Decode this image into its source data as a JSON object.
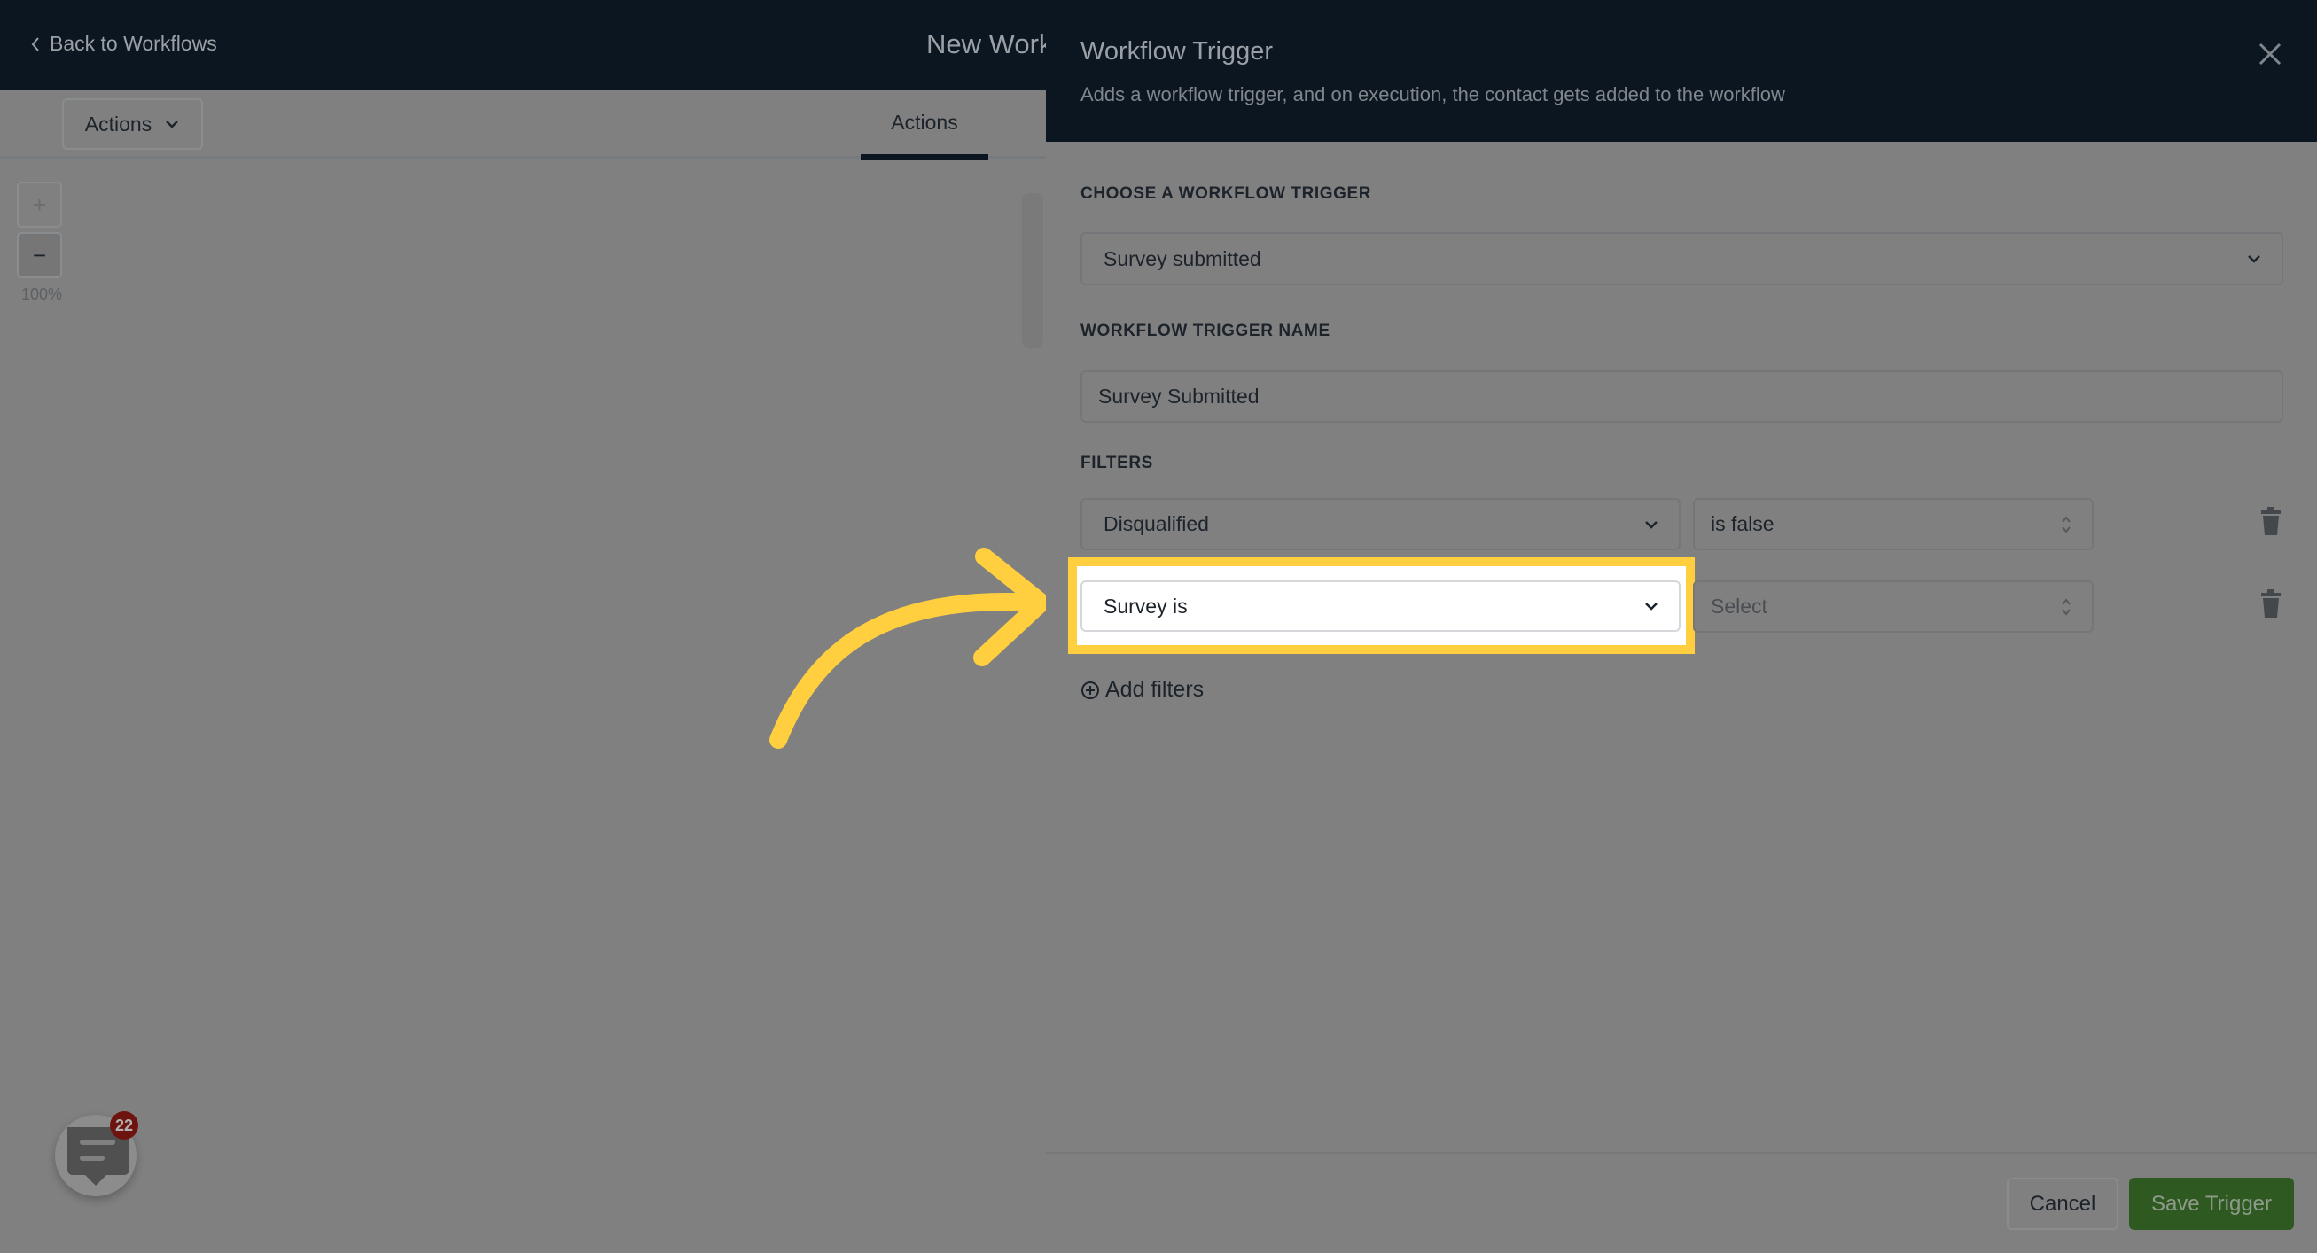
{
  "header": {
    "back_label": "Back to Workflows",
    "workflow_name": "New Workflow"
  },
  "toolbar": {
    "actions_dropdown": "Actions",
    "tab_actions": "Actions"
  },
  "zoom": {
    "plus": "+",
    "minus": "−",
    "level": "100%"
  },
  "chat": {
    "badge_count": "22"
  },
  "panel": {
    "title": "Workflow Trigger",
    "subtitle": "Adds a workflow trigger, and on execution, the contact gets added to the workflow",
    "trigger_label": "CHOOSE A WORKFLOW TRIGGER",
    "trigger_value": "Survey submitted",
    "name_label": "WORKFLOW TRIGGER NAME",
    "name_value": "Survey Submitted",
    "filters_label": "FILTERS",
    "filters": [
      {
        "field": "Disqualified",
        "operator": "is false"
      },
      {
        "field": "Survey is",
        "operator": "Select"
      }
    ],
    "add_filters": "Add filters",
    "cancel": "Cancel",
    "save": "Save Trigger"
  },
  "colors": {
    "header": "#0c1620",
    "highlight": "#ffcf3f",
    "save_button": "#2e5a22",
    "badge": "#6e1410"
  }
}
